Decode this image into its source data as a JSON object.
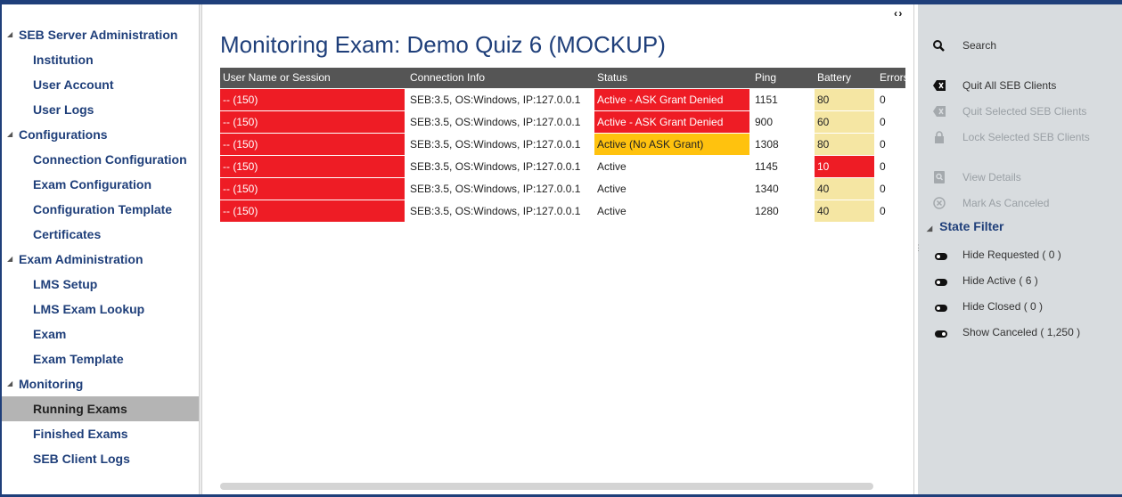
{
  "nav": {
    "items": [
      {
        "label": "SEB Server Administration",
        "kind": "category"
      },
      {
        "label": "Institution",
        "kind": "item"
      },
      {
        "label": "User Account",
        "kind": "item"
      },
      {
        "label": "User Logs",
        "kind": "item"
      },
      {
        "label": "Configurations",
        "kind": "category"
      },
      {
        "label": "Connection Configuration",
        "kind": "item"
      },
      {
        "label": "Exam Configuration",
        "kind": "item"
      },
      {
        "label": "Configuration Template",
        "kind": "item"
      },
      {
        "label": "Certificates",
        "kind": "item"
      },
      {
        "label": "Exam Administration",
        "kind": "category"
      },
      {
        "label": "LMS Setup",
        "kind": "item"
      },
      {
        "label": "LMS Exam Lookup",
        "kind": "item"
      },
      {
        "label": "Exam",
        "kind": "item"
      },
      {
        "label": "Exam Template",
        "kind": "item"
      },
      {
        "label": "Monitoring",
        "kind": "category"
      },
      {
        "label": "Running Exams",
        "kind": "item",
        "selected": true
      },
      {
        "label": "Finished Exams",
        "kind": "item"
      },
      {
        "label": "SEB Client Logs",
        "kind": "item"
      }
    ]
  },
  "main": {
    "title": "Monitoring Exam: Demo Quiz 6 (MOCKUP)",
    "table": {
      "columns": [
        "User Name or Session",
        "Connection Info",
        "Status",
        "Ping",
        "Battery",
        "Errors"
      ],
      "rows": [
        {
          "user": "-- (150)",
          "conn": "SEB:3.5, OS:Windows, IP:127.0.0.1",
          "status": "Active - ASK Grant Denied",
          "ping": "1151",
          "battery": "80",
          "errors": "0",
          "status_style": "red",
          "battery_style": "yellow"
        },
        {
          "user": "-- (150)",
          "conn": "SEB:3.5, OS:Windows, IP:127.0.0.1",
          "status": "Active - ASK Grant Denied",
          "ping": "900",
          "battery": "60",
          "errors": "0",
          "status_style": "red",
          "battery_style": "yellow"
        },
        {
          "user": "-- (150)",
          "conn": "SEB:3.5, OS:Windows, IP:127.0.0.1",
          "status": "Active  (No ASK Grant)",
          "ping": "1308",
          "battery": "80",
          "errors": "0",
          "status_style": "orange",
          "battery_style": "yellow"
        },
        {
          "user": "-- (150)",
          "conn": "SEB:3.5, OS:Windows, IP:127.0.0.1",
          "status": "Active",
          "ping": "1145",
          "battery": "10",
          "errors": "0",
          "status_style": "none",
          "battery_style": "red"
        },
        {
          "user": "-- (150)",
          "conn": "SEB:3.5, OS:Windows, IP:127.0.0.1",
          "status": "Active",
          "ping": "1340",
          "battery": "40",
          "errors": "0",
          "status_style": "none",
          "battery_style": "yellow"
        },
        {
          "user": "-- (150)",
          "conn": "SEB:3.5, OS:Windows, IP:127.0.0.1",
          "status": "Active",
          "ping": "1280",
          "battery": "40",
          "errors": "0",
          "status_style": "none",
          "battery_style": "yellow"
        }
      ]
    }
  },
  "actions": {
    "search": "Search",
    "quit_all": "Quit All SEB Clients",
    "quit_selected": "Quit Selected SEB Clients",
    "lock_selected": "Lock Selected SEB Clients",
    "view_details": "View Details",
    "mark_canceled": "Mark As Canceled",
    "state_filter": "State Filter",
    "filters": [
      {
        "label": "Hide Requested ( 0 )",
        "on": false
      },
      {
        "label": "Hide Active ( 6 )",
        "on": false
      },
      {
        "label": "Hide Closed ( 0 )",
        "on": false
      },
      {
        "label": "Show Canceled ( 1,250 )",
        "on": true
      }
    ]
  },
  "colors": {
    "brand": "#1f3f7a",
    "status_red": "#ee1c25",
    "status_orange": "#ffc20e",
    "battery_yellow": "#f5e6a3",
    "header_gray": "#555555",
    "selected_gray": "#b4b4b4"
  }
}
